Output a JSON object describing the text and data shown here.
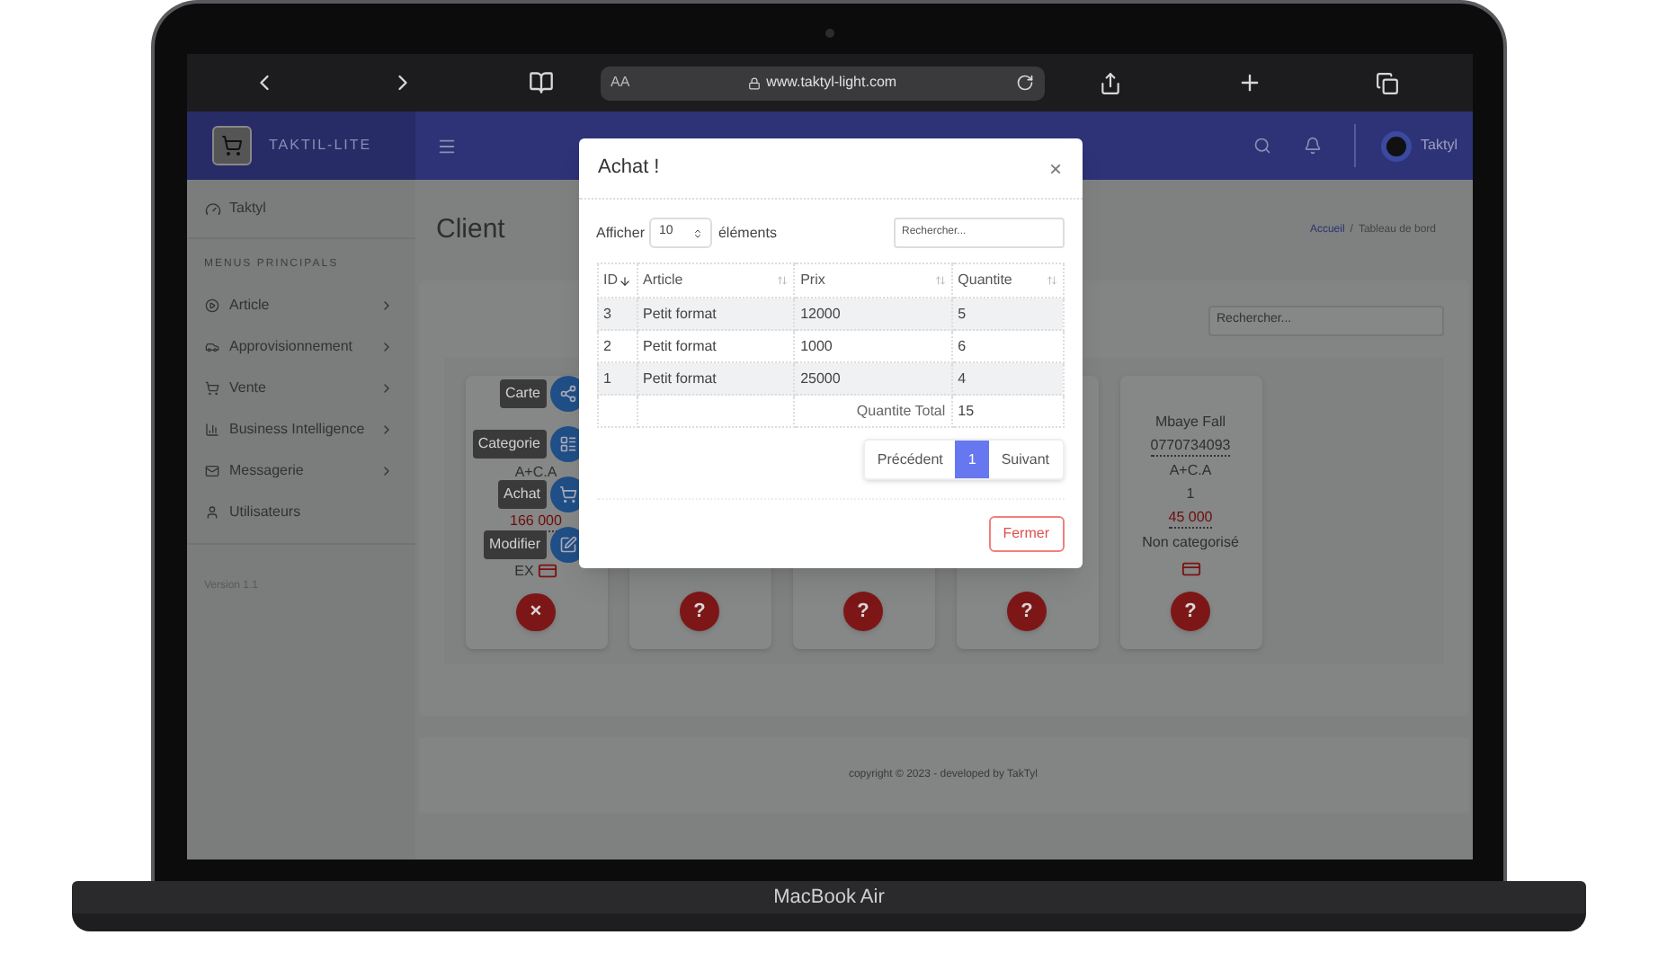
{
  "browser": {
    "text_size": "AA",
    "url": "www.taktyl-light.com"
  },
  "header": {
    "brand": "TAKTIL-LITE",
    "user": "Taktyl"
  },
  "sidebar": {
    "user": "Taktyl",
    "section": "MENUS PRINCIPALS",
    "items": [
      {
        "label": "Article",
        "has_submenu": true
      },
      {
        "label": "Approvisionnement",
        "has_submenu": true
      },
      {
        "label": "Vente",
        "has_submenu": true
      },
      {
        "label": "Business Intelligence",
        "has_submenu": true
      },
      {
        "label": "Messagerie",
        "has_submenu": true
      },
      {
        "label": "Utilisateurs",
        "has_submenu": false
      }
    ],
    "version": "Version 1.1"
  },
  "page": {
    "title": "Client",
    "breadcrumb": [
      "Accueil",
      "Tableau de bord"
    ],
    "breadcrumb_separator": "/",
    "search_placeholder": "Rechercher...",
    "cards": [
      {
        "lines": [
          {
            "text": "A+C.A",
            "kind": "plain"
          },
          {
            "text": "166 000",
            "kind": "price"
          },
          {
            "text": "EX",
            "kind": "plain"
          }
        ],
        "payment_icon": true,
        "button": "×",
        "actions": [
          "Carte",
          "Categorie",
          "Achat",
          "Modifier"
        ]
      },
      {
        "payment_icon": false,
        "button": "?"
      },
      {
        "payment_icon": false,
        "button": "?"
      },
      {
        "payment_icon": false,
        "button": "?"
      },
      {
        "lines": [
          {
            "text": "Mbaye Fall",
            "kind": "plain"
          },
          {
            "text": "0770734093",
            "kind": "underlined"
          },
          {
            "text": "A+C.A",
            "kind": "plain"
          },
          {
            "text": "1",
            "kind": "plain"
          },
          {
            "text": "45 000",
            "kind": "price"
          },
          {
            "text": "Non categorisé",
            "kind": "plain"
          }
        ],
        "payment_icon": true,
        "button": "?"
      }
    ]
  },
  "footer": "copyright © 2023 - developed by TakTyl",
  "modal": {
    "title": "Achat !",
    "close": "×",
    "show_before": "Afficher",
    "length": "10",
    "show_after": "éléments",
    "search_placeholder": "Rechercher...",
    "columns": [
      {
        "label": "ID",
        "sorted": true
      },
      {
        "label": "Article",
        "sorted": false
      },
      {
        "label": "Prix",
        "sorted": false
      },
      {
        "label": "Quantite",
        "sorted": false
      }
    ],
    "rows": [
      [
        "3",
        "Petit format",
        "12000",
        "5"
      ],
      [
        "2",
        "Petit format",
        "1000",
        "6"
      ],
      [
        "1",
        "Petit format",
        "25000",
        "4"
      ]
    ],
    "total_label": "Quantite Total",
    "total": "15",
    "pagination": [
      {
        "label": "Précédent",
        "selected": false
      },
      {
        "label": "1",
        "selected": true
      },
      {
        "label": "Suivant",
        "selected": false
      }
    ],
    "close_button": "Fermer"
  },
  "laptop": {
    "model": "MacBook Air"
  }
}
